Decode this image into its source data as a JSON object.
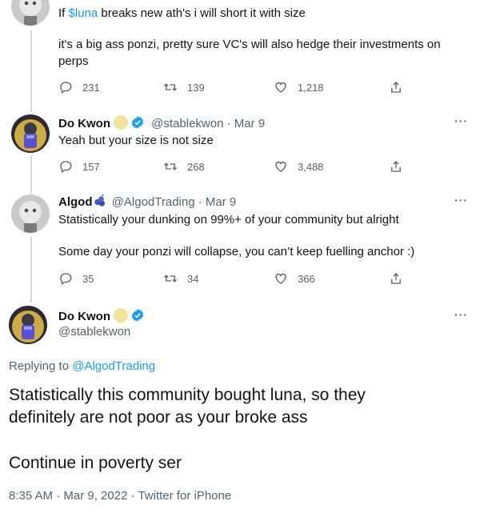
{
  "tweet1": {
    "text_prefix": "If ",
    "cashtag": "$luna",
    "text_suffix": " breaks new ath's i will short it with size",
    "paragraph2_line1": "it's a big ass ponzi, pretty sure VC's will also hedge their investments on",
    "paragraph2_line2": "perps",
    "replies": "231",
    "retweets": "139",
    "likes": "1,218"
  },
  "tweet2": {
    "name": "Do Kwon",
    "handle_date": "@stablekwon · Mar 9",
    "text": "Yeah but your size is not size",
    "replies": "157",
    "retweets": "268",
    "likes": "3,488"
  },
  "tweet3": {
    "name": "Algod",
    "handle_date": "@AlgodTrading · Mar 9",
    "line1": "Statistically your dunking on 99%+ of your community but alright",
    "line2": "Some day your ponzi will collapse, you can’t keep fuelling anchor :)",
    "replies": "35",
    "retweets": "34",
    "likes": "366"
  },
  "main_tweet": {
    "name": "Do Kwon",
    "handle": "@stablekwon",
    "replying_prefix": "Replying to ",
    "replying_handle": "@AlgodTrading",
    "line1": "Statistically this community bought luna, so they",
    "line2": "definitely are not poor as your broke ass",
    "line3": "Continue in poverty ser",
    "timestamp": "8:35 AM · Mar 9, 2022 · Twitter for iPhone"
  },
  "more_label": "···",
  "icons": {
    "reply": "reply-icon",
    "retweet": "retweet-icon",
    "like": "like-icon",
    "share": "share-icon",
    "verified": "verified-badge-icon",
    "coin": "coin-emoji-icon",
    "blueberries": "blueberries-emoji-icon"
  },
  "colors": {
    "link": "#1d9bf0",
    "text": "#0f1419",
    "secondary": "#536471",
    "thread_line": "#cfd9de"
  }
}
